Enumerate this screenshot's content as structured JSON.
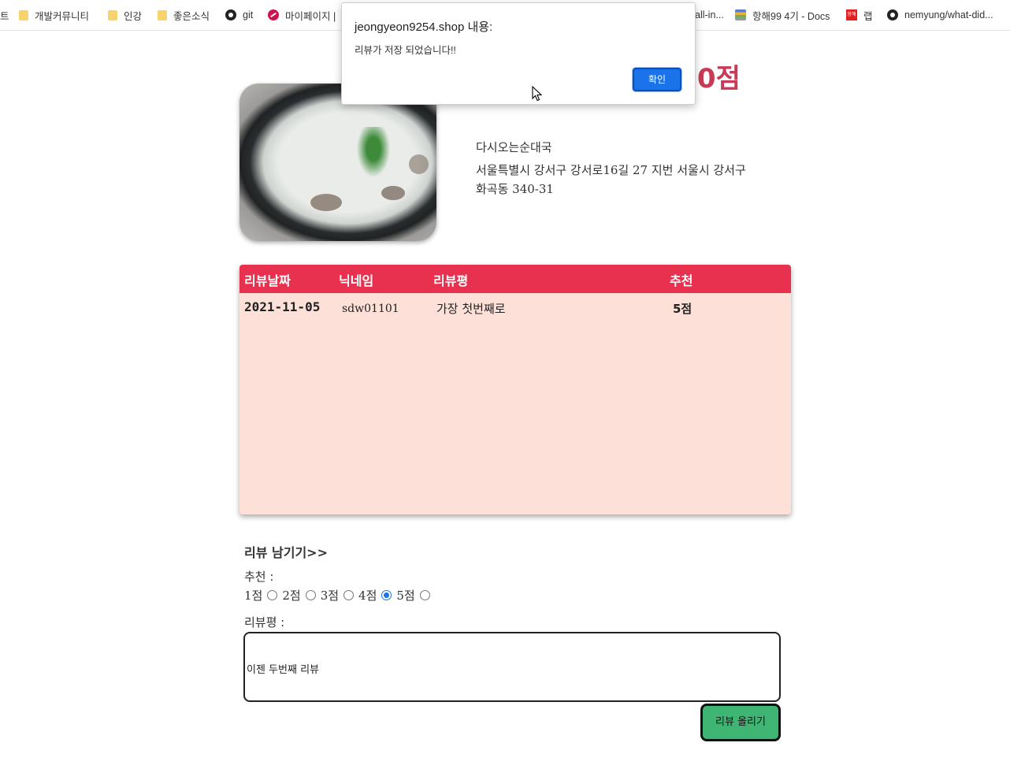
{
  "bookmarks": [
    {
      "label": "트",
      "icon": "none"
    },
    {
      "label": "개발커뮤니티",
      "icon": "folder-icon"
    },
    {
      "label": "인강",
      "icon": "folder-icon"
    },
    {
      "label": "좋은소식",
      "icon": "folder-icon"
    },
    {
      "label": "git",
      "icon": "github-icon"
    },
    {
      "label": "마이페이지 |",
      "icon": "mypage-icon"
    },
    {
      "label": "all-in...",
      "icon": "none"
    },
    {
      "label": "항해99 4기 - Docs",
      "icon": "docs-icon"
    },
    {
      "label": "랩",
      "icon": "hanghae-icon"
    },
    {
      "label": "nemyung/what-did...",
      "icon": "github-icon"
    }
  ],
  "store": {
    "score_visible": ".0점",
    "name": "다시오는순대국",
    "address": "서울특별시 강서구 강서로16길 27 지번 서울시 강서구 화곡동 340-31"
  },
  "review_table": {
    "headers": [
      "리뷰날짜",
      "닉네임",
      "리뷰평",
      "추천"
    ],
    "rows": [
      {
        "date": "2021-11-05",
        "nickname": "sdw01101",
        "comment": "가장 첫번째로",
        "recommend": "5점"
      }
    ]
  },
  "review_form": {
    "heading": "리뷰 남기기>>",
    "recommend_label": "추천 :",
    "rating_options": [
      "1점",
      "2점",
      "3점",
      "4점",
      "5점"
    ],
    "selected_rating": "4점",
    "comment_label": "리뷰평 :",
    "comment_value": "이젠 두번째 리뷰",
    "submit_label": "리뷰 올리기"
  },
  "alert": {
    "title": "jeongyeon9254.shop 내용:",
    "message": "리뷰가 저장 되었습니다!!",
    "ok_label": "확인"
  },
  "colors": {
    "table_header": "#e8304f",
    "table_body": "#fde0d7",
    "score": "#c93a57",
    "submit_button": "#3fb573",
    "alert_button": "#1a73e8"
  }
}
